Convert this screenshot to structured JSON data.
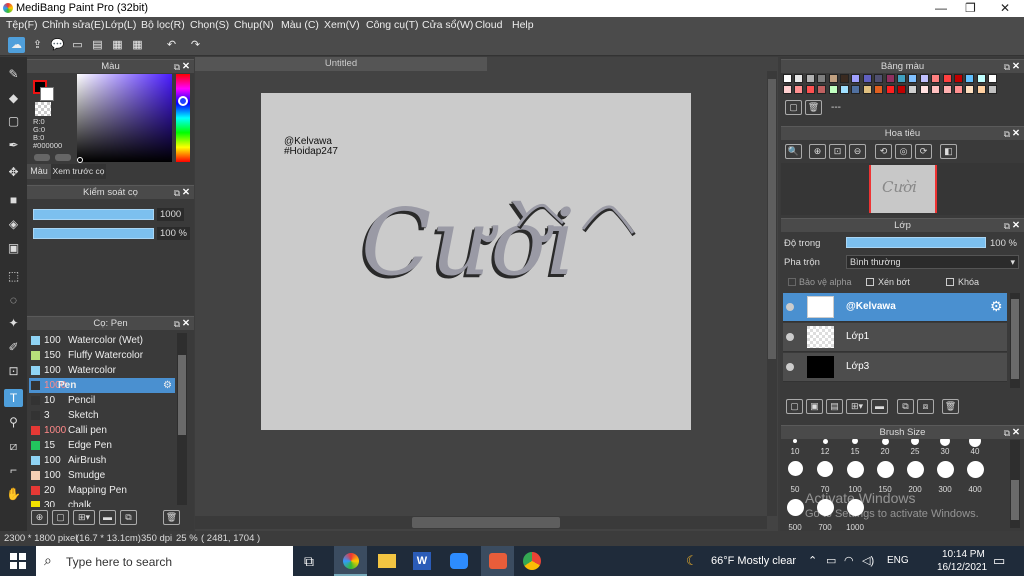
{
  "window": {
    "title": "MediBang Paint Pro (32bit)",
    "minimize": "—",
    "maximize": "❐",
    "close": "✕"
  },
  "menu": [
    "Tệp(F)",
    "Chỉnh sửa(E)",
    "Lớp(L)",
    "Bộ lọc(R)",
    "Chọn(S)",
    "Chụp(N)",
    "Màu (C)",
    "Xem(V)",
    "Công cụ(T)",
    "Cửa sổ(W)",
    "Cloud",
    "Help"
  ],
  "color_panel": {
    "title": "Màu",
    "r": "R:0",
    "g": "G:0",
    "b": "B:0",
    "hex": "#000000",
    "tab1": "Màu",
    "tab2": "Xem trước cọ"
  },
  "brush_control": {
    "title": "Kiểm soát cọ",
    "size": "1000",
    "size_fraction": 1.0,
    "opacity": "100 %",
    "opacity_fraction": 1.0
  },
  "brush_list": {
    "title": "Cọ: Pen",
    "items": [
      {
        "size": "100",
        "name": "Watercolor (Wet)",
        "color": "#8fd3f4"
      },
      {
        "size": "150",
        "name": "Fluffy Watercolor",
        "color": "#b7e07a"
      },
      {
        "size": "100",
        "name": "Watercolor",
        "color": "#8fd3f4"
      },
      {
        "size": "1000",
        "name": "Pen",
        "color": "#333333",
        "selected": true
      },
      {
        "size": "10",
        "name": "Pencil",
        "color": "#333333"
      },
      {
        "size": "3",
        "name": "Sketch",
        "color": "#333333"
      },
      {
        "size": "1000",
        "name": "Calli pen",
        "color": "#e53935"
      },
      {
        "size": "15",
        "name": "Edge Pen",
        "color": "#22c55e"
      },
      {
        "size": "100",
        "name": "AirBrush",
        "color": "#8fd3f4"
      },
      {
        "size": "100",
        "name": "Smudge",
        "color": "#f5d0b5"
      },
      {
        "size": "20",
        "name": "Mapping Pen",
        "color": "#e53935"
      },
      {
        "size": "30",
        "name": "chalk",
        "color": "#f2e200"
      }
    ]
  },
  "canvas": {
    "tab": "Untitled",
    "text_line1": "@Kelvawa",
    "text_line2": "#Hoidap247",
    "art_text": "Cười",
    "art_caret": "^ ^"
  },
  "palette": {
    "title": "Bảng màu",
    "name": "---",
    "colors": [
      "#ffffff",
      "#e6e6e6",
      "#b3b3b3",
      "#7f7f7f",
      "#c0a080",
      "#3a2a20",
      "#a0a0ff",
      "#6060c0",
      "#505070",
      "#903060",
      "#40a0c0",
      "#80c0ff",
      "#c0c0ff",
      "#ff8080",
      "#ff4040",
      "#c00000",
      "#60c0ff",
      "#c0ffff",
      "#ffffff",
      "#ffd0d0",
      "#ff9090",
      "#ff5050",
      "#c06060",
      "#c0ffc0",
      "#a0e0ff",
      "#5070a0",
      "#e0c080",
      "#e06020",
      "#ff2020",
      "#c00000",
      "#d0d0d0",
      "#ffe0e0",
      "#ffc0c0",
      "#ffb0b0",
      "#ff9090",
      "#ffe0c0",
      "#ffd0a0",
      "#c0c0c0"
    ]
  },
  "navigator": {
    "title": "Hoa tiêu"
  },
  "layers": {
    "title": "Lớp",
    "opacity_label": "Độ trong",
    "opacity_value": "100 %",
    "opacity_fraction": 1.0,
    "blend_label": "Pha trộn",
    "blend_value": "Bình thường",
    "protect_alpha": "Bảo vệ alpha",
    "clip": "Xén bớt",
    "lock": "Khóa",
    "items": [
      {
        "name": "@Kelvawa",
        "selected": true
      },
      {
        "name": "Lớp1"
      },
      {
        "name": "Lớp3"
      }
    ]
  },
  "brush_size": {
    "title": "Brush Size",
    "row1": [
      "10",
      "12",
      "15",
      "20",
      "25",
      "30",
      "40"
    ],
    "row2": [
      "50",
      "70",
      "100",
      "150",
      "200",
      "300",
      "400"
    ],
    "row3": [
      "500",
      "700",
      "1000"
    ]
  },
  "watermark": {
    "line1": "Activate Windows",
    "line2": "Go to Settings to activate Windows."
  },
  "status": {
    "size": "2300 * 1800 pixel",
    "cm": "(16.7 * 13.1cm)",
    "dpi": "350 dpi",
    "zoom": "25 %",
    "coords": "( 2481, 1704 )"
  },
  "taskbar": {
    "search_placeholder": "Type here to search",
    "weather": "66°F  Mostly clear",
    "lang": "ENG",
    "time": "10:14 PM",
    "date": "16/12/2021"
  },
  "colors": {
    "accent": "#4f9fdb",
    "selected_row": "#4a90d0",
    "paper": "#cbcbcb"
  }
}
